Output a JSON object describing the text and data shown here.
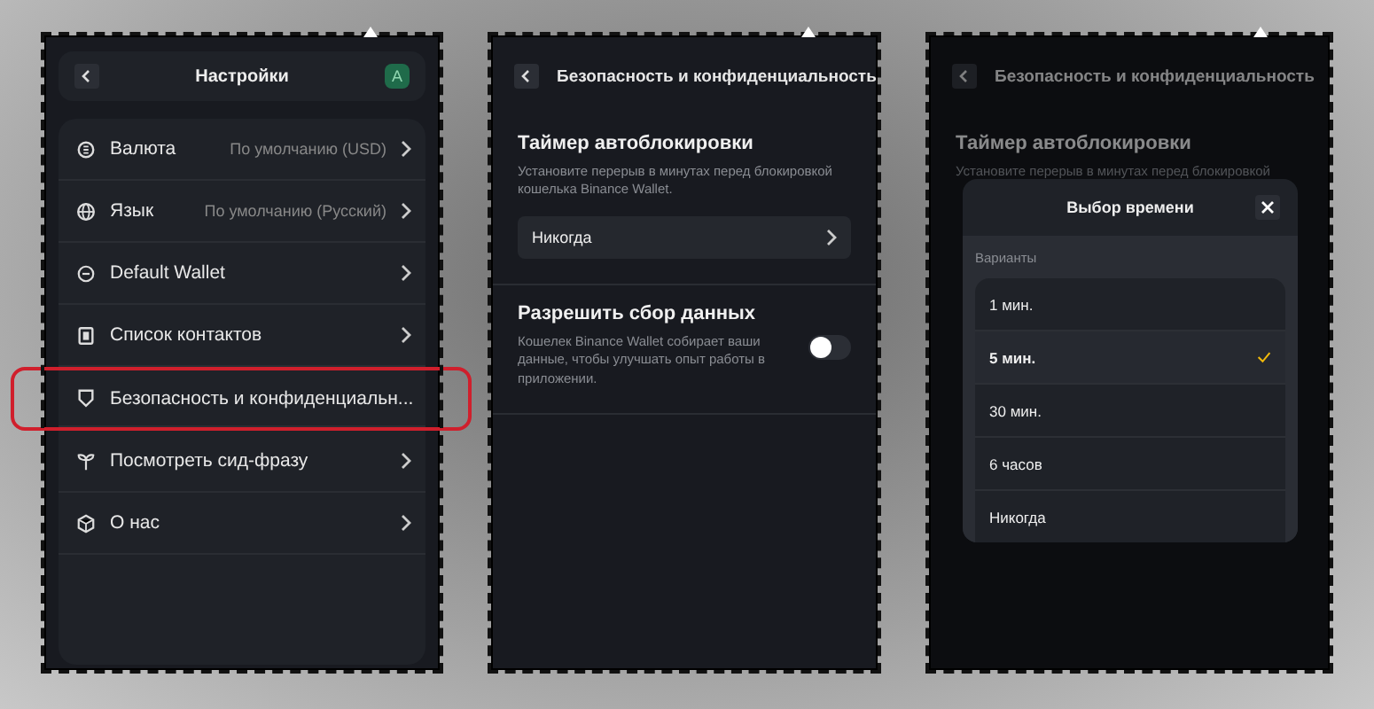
{
  "settings": {
    "title": "Настройки",
    "avatar": "A",
    "items": [
      {
        "label": "Валюта",
        "value": "По умолчанию (USD)",
        "highlighted": false
      },
      {
        "label": "Язык",
        "value": "По умолчанию (Русский)",
        "highlighted": false
      },
      {
        "label": "Default Wallet",
        "highlighted": false
      },
      {
        "label": "Список контактов",
        "highlighted": false
      },
      {
        "label": "Безопасность и конфиденциальн...",
        "highlighted": true
      },
      {
        "label": "Посмотреть сид-фразу",
        "highlighted": false
      },
      {
        "label": "О нас",
        "highlighted": false
      }
    ]
  },
  "security": {
    "title": "Безопасность и конфиденциальность",
    "timer": {
      "title": "Таймер автоблокировки",
      "description": "Установите перерыв в минутах перед блокировкой кошелька Binance Wallet.",
      "value": "Никогда"
    },
    "data_collection": {
      "title": "Разрешить сбор данных",
      "description": "Кошелек Binance Wallet собирает ваши данные, чтобы улучшать опыт работы в приложении.",
      "on": false
    }
  },
  "picker": {
    "background_title": "Безопасность и конфиденциальность",
    "background_heading": "Таймер автоблокировки",
    "background_description": "Установите перерыв в минутах перед блокировкой",
    "title": "Выбор времени",
    "section_label": "Варианты",
    "options": [
      {
        "label": "1 мин.",
        "selected": false
      },
      {
        "label": "5 мин.",
        "selected": true
      },
      {
        "label": "30 мин.",
        "selected": false
      },
      {
        "label": "6 часов",
        "selected": false
      },
      {
        "label": "Никогда",
        "selected": false
      }
    ]
  }
}
